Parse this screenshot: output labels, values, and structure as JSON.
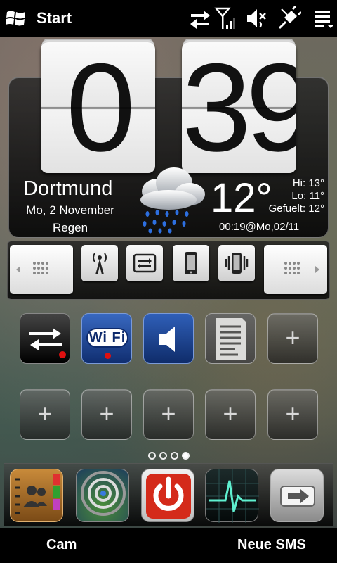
{
  "status_bar": {
    "title": "Start",
    "icons": [
      "windows-start-icon",
      "data-sync-icon",
      "signal-icon",
      "speaker-muted-icon",
      "plug-charging-icon",
      "menu-icon"
    ]
  },
  "clock": {
    "hours": "0",
    "minutes": "39"
  },
  "weather": {
    "city": "Dortmund",
    "date": "Mo, 2 November",
    "condition": "Regen",
    "temperature": "12°",
    "hi": "Hi: 13°",
    "lo": "Lo: 11°",
    "feels": "Gefuelt: 12°",
    "updated": "00:19@Mo,02/11",
    "icon": "rain-cloud-icon"
  },
  "quick_settings": {
    "buttons": [
      "wireless-antenna-icon",
      "sync-toggle-icon",
      "phone-device-icon",
      "vibrate-icon"
    ]
  },
  "shortcuts": {
    "row1": [
      "data-connection-icon",
      "wifi-icon",
      "sound-icon",
      "notes-icon",
      "add-shortcut"
    ],
    "row2": [
      "add-shortcut",
      "add-shortcut",
      "add-shortcut",
      "add-shortcut",
      "add-shortcut"
    ],
    "wifi_label": "Wi Fi",
    "plus": "+"
  },
  "pager": {
    "pages": 4,
    "active": 4
  },
  "dock": [
    "contacts-icon",
    "gps-icon",
    "power-icon",
    "heart-monitor-icon",
    "exit-arrow-icon"
  ],
  "softkeys": {
    "left": "Cam",
    "right": "Neue SMS"
  },
  "colors": {
    "wifi_blue": "#1d4aa0",
    "power_red": "#d42a1a",
    "accent_red": "#e01010"
  }
}
